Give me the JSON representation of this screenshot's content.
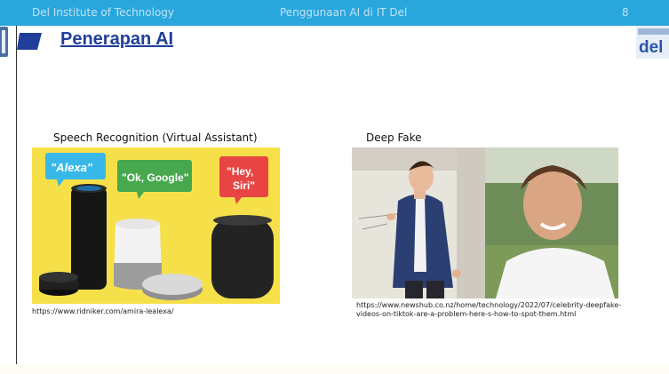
{
  "header": {
    "institution": "Del Institute of Technology",
    "topic": "Penggunaan AI di IT Del",
    "page_number": "8"
  },
  "slide": {
    "title": "Penerapan AI",
    "items": [
      {
        "caption": "Speech Recognition (Virtual Assistant)",
        "bubbles": [
          "\"Alexa\"",
          "\"Ok, Google\"",
          "\"Hey,",
          "Siri\""
        ],
        "source": "https://www.ridniker.com/amira-lealexa/"
      },
      {
        "caption": "Deep Fake",
        "source": "https://www.newshub.co.nz/home/technology/2022/07/celebrity-deepfake-videos-on-tiktok-are-a-problem-here-s-how-to-spot-them.html"
      }
    ]
  },
  "logo": {
    "text": "del"
  },
  "colors": {
    "header_bar": "#29a6dc",
    "title": "#1f3f9a",
    "image1_background": "#f6e04a"
  }
}
